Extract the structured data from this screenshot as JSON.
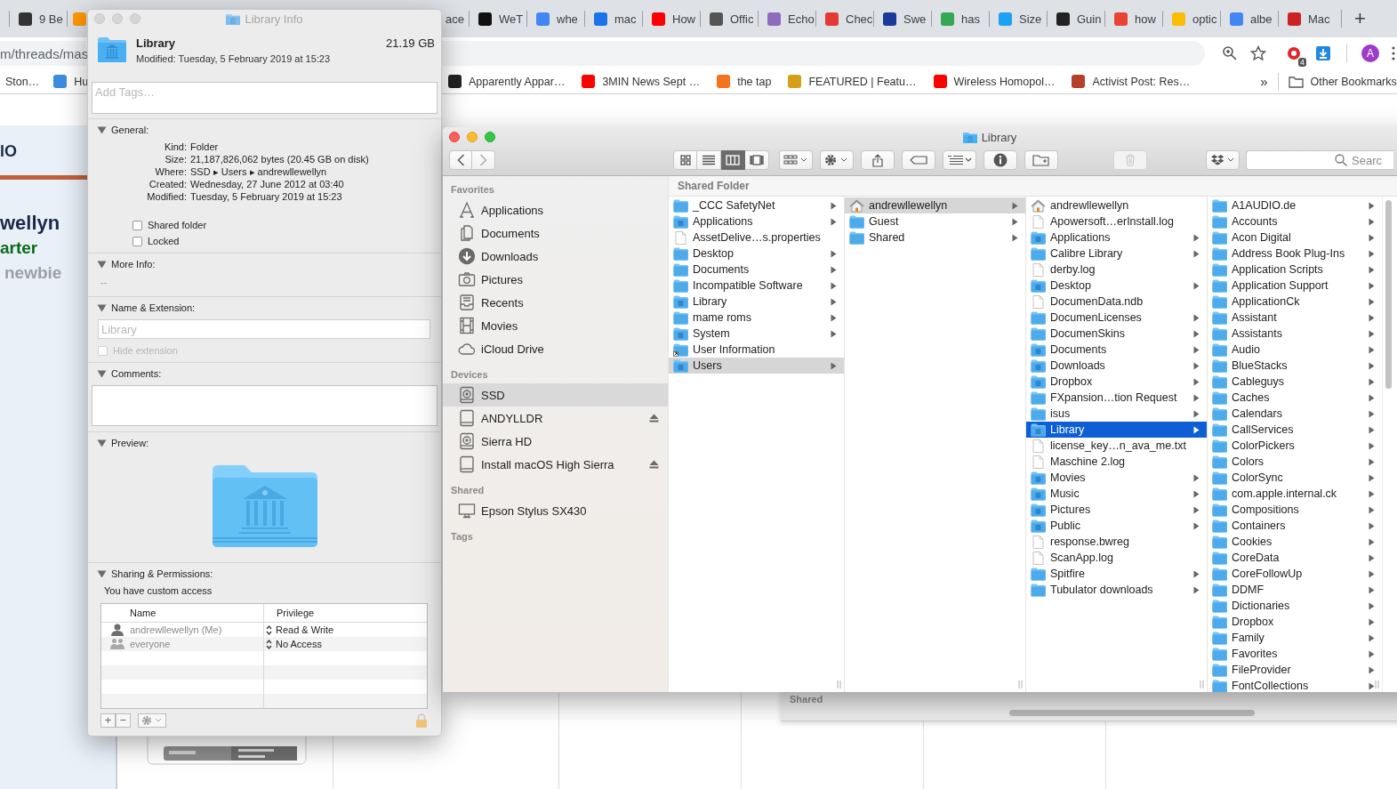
{
  "browser": {
    "tabs_left": [
      {
        "label": "9 Be",
        "color": "#333333"
      },
      {
        "color": "#ff9900"
      }
    ],
    "tabs_right": [
      {
        "label": "ace"
      },
      {
        "label": "WeT",
        "color": "#111111"
      },
      {
        "label": "whe",
        "color": "#4285f4"
      },
      {
        "label": "mac",
        "color": "#1a73e8"
      },
      {
        "label": "How",
        "color": "#ff0000"
      },
      {
        "label": "Offic",
        "color": "#555555"
      },
      {
        "label": "Echo",
        "color": "#8e6bbf"
      },
      {
        "label": "Chec",
        "color": "#e53935"
      },
      {
        "label": "Swe",
        "color": "#1a3a9a"
      },
      {
        "label": "has",
        "color": "#34a853"
      },
      {
        "label": "Size",
        "color": "#1da1f2"
      },
      {
        "label": "Guin",
        "color": "#222222"
      },
      {
        "label": "how",
        "color": "#ea4335"
      },
      {
        "label": "optic",
        "color": "#fbbc05"
      },
      {
        "label": "albe",
        "color": "#4285f4"
      },
      {
        "label": "Mac",
        "color": "#cc2222"
      }
    ],
    "new_tab": "+",
    "address": "m/threads/mas",
    "extension_badge": "4",
    "avatar": "A",
    "bookmarks_left": [
      {
        "label": "Ston…"
      },
      {
        "label": "Hu",
        "color": "#3b8de0"
      }
    ],
    "bookmarks_right": [
      {
        "label": "Apparently Appar…",
        "color": "#222222"
      },
      {
        "label": "3MIN News Sept …",
        "color": "#ff0000"
      },
      {
        "label": "the tap",
        "color": "#f4731f"
      },
      {
        "label": "FEATURED | Featu…",
        "color": "#d4a017"
      },
      {
        "label": "Wireless Homopol…",
        "color": "#ff0000"
      },
      {
        "label": "Activist Post: Res…",
        "color": "#b5402a"
      }
    ],
    "more": "»",
    "other_bookmarks": "Other Bookmarks"
  },
  "page": {
    "texts": [
      {
        "kind": "heading",
        "text": "lO"
      },
      {
        "kind": "name",
        "text": "wellyn"
      },
      {
        "kind": "rank",
        "text": "arter"
      },
      {
        "kind": "status",
        "text": "newbie"
      }
    ]
  },
  "info": {
    "title": "Library Info",
    "name": "Library",
    "size": "21.19 GB",
    "modified": "Modified: Tuesday, 5 February 2019 at 15:23",
    "tags_placeholder": "Add Tags…",
    "sections": [
      {
        "kind": "general",
        "title": "General:",
        "expanded": true,
        "rows": [
          {
            "label": "Kind:",
            "value": "Folder"
          },
          {
            "label": "Size:",
            "value": "21,187,826,062 bytes (20.45 GB on disk)"
          },
          {
            "label": "Where:",
            "value": "SSD ▸ Users ▸ andrewllewellyn"
          },
          {
            "label": "Created:",
            "value": "Wednesday, 27 June 2012 at 03:40"
          },
          {
            "label": "Modified:",
            "value": "Tuesday, 5 February 2019 at 15:23"
          }
        ],
        "checkboxes": [
          {
            "label": "Shared folder",
            "checked": false
          },
          {
            "label": "Locked",
            "checked": false
          }
        ]
      },
      {
        "kind": "more",
        "title": "More Info:",
        "expanded": true,
        "text": "--"
      },
      {
        "kind": "name",
        "title": "Name & Extension:",
        "expanded": true,
        "value": "Library",
        "disabled": true,
        "checkbox": {
          "label": "Hide extension",
          "checked": false,
          "disabled": true
        }
      },
      {
        "kind": "comments",
        "title": "Comments:",
        "expanded": true
      },
      {
        "kind": "preview",
        "title": "Preview:",
        "expanded": true
      },
      {
        "kind": "sharing",
        "title": "Sharing & Permissions:",
        "expanded": true,
        "note": "You have custom access",
        "columns": [
          "Name",
          "Privilege"
        ],
        "rows": [
          {
            "name": "andrewllewellyn (Me)",
            "kind": "user",
            "privilege": "Read & Write"
          },
          {
            "name": "everyone",
            "kind": "group",
            "privilege": "No Access"
          }
        ],
        "add": "+",
        "remove": "−"
      }
    ]
  },
  "finder": {
    "title": "Library",
    "views": [
      {
        "kind": "icons",
        "selected": false
      },
      {
        "kind": "list",
        "selected": false
      },
      {
        "kind": "columns",
        "selected": true
      },
      {
        "kind": "gallery",
        "selected": false
      }
    ],
    "trash_disabled": true,
    "search_placeholder": "Searc",
    "sidebar": [
      {
        "heading": "Favorites",
        "items": [
          {
            "name": "Applications",
            "kind": "apps",
            "selected": false,
            "eject": false
          },
          {
            "name": "Documents",
            "kind": "documents",
            "selected": false,
            "eject": false
          },
          {
            "name": "Downloads",
            "kind": "downloads",
            "selected": false,
            "eject": false
          },
          {
            "name": "Pictures",
            "kind": "pictures",
            "selected": false,
            "eject": false
          },
          {
            "name": "Recents",
            "kind": "recents",
            "selected": false,
            "eject": false
          },
          {
            "name": "Movies",
            "kind": "movies",
            "selected": false,
            "eject": false
          },
          {
            "name": "iCloud Drive",
            "kind": "cloud",
            "selected": false,
            "eject": false
          }
        ]
      },
      {
        "heading": "Devices",
        "items": [
          {
            "name": "SSD",
            "kind": "disk",
            "selected": true,
            "eject": false
          },
          {
            "name": "ANDYLLDR",
            "kind": "drive",
            "selected": false,
            "eject": true
          },
          {
            "name": "Sierra HD",
            "kind": "disk",
            "selected": false,
            "eject": false
          },
          {
            "name": "Install macOS High Sierra",
            "kind": "drive",
            "selected": false,
            "eject": true
          }
        ]
      },
      {
        "heading": "Shared",
        "items": [
          {
            "name": "Epson Stylus SX430",
            "kind": "display",
            "selected": false,
            "eject": false
          }
        ]
      },
      {
        "heading": "Tags"
      }
    ],
    "path_header": "Shared Folder",
    "columns": [
      {
        "focused": false,
        "items": [
          {
            "name": "_CCC SafetyNet",
            "kind": "folder",
            "arrow": true,
            "selected": false
          },
          {
            "name": "Applications",
            "kind": "special",
            "arrow": true,
            "selected": false
          },
          {
            "name": "AssetDelive…s.properties",
            "kind": "file",
            "arrow": false,
            "selected": false
          },
          {
            "name": "Desktop",
            "kind": "folder",
            "arrow": true,
            "selected": false
          },
          {
            "name": "Documents",
            "kind": "folder",
            "arrow": true,
            "selected": false
          },
          {
            "name": "Incompatible Software",
            "kind": "folder",
            "arrow": true,
            "selected": false
          },
          {
            "name": "Library",
            "kind": "special",
            "arrow": true,
            "selected": false
          },
          {
            "name": "mame roms",
            "kind": "folder",
            "arrow": true,
            "selected": false
          },
          {
            "name": "System",
            "kind": "special",
            "arrow": true,
            "selected": false
          },
          {
            "name": "User Information",
            "kind": "alias",
            "arrow": false,
            "selected": false
          },
          {
            "name": "Users",
            "kind": "special",
            "arrow": true,
            "selected": true
          }
        ]
      },
      {
        "focused": false,
        "items": [
          {
            "name": "andrewllewellyn",
            "kind": "home",
            "arrow": true,
            "selected": true
          },
          {
            "name": "Guest",
            "kind": "folder",
            "arrow": true,
            "selected": false
          },
          {
            "name": "Shared",
            "kind": "folder",
            "arrow": true,
            "selected": false
          }
        ]
      },
      {
        "focused": true,
        "items": [
          {
            "name": "andrewllewellyn",
            "kind": "home",
            "arrow": false,
            "selected": false
          },
          {
            "name": "Apowersoft…erInstall.log",
            "kind": "file",
            "arrow": false,
            "selected": false
          },
          {
            "name": "Applications",
            "kind": "special",
            "arrow": true,
            "selected": false
          },
          {
            "name": "Calibre Library",
            "kind": "folder",
            "arrow": true,
            "selected": false
          },
          {
            "name": "derby.log",
            "kind": "file",
            "arrow": false,
            "selected": false
          },
          {
            "name": "Desktop",
            "kind": "special",
            "arrow": true,
            "selected": false
          },
          {
            "name": "DocumenData.ndb",
            "kind": "file",
            "arrow": false,
            "selected": false
          },
          {
            "name": "DocumenLicenses",
            "kind": "folder",
            "arrow": true,
            "selected": false
          },
          {
            "name": "DocumenSkins",
            "kind": "folder",
            "arrow": true,
            "selected": false
          },
          {
            "name": "Documents",
            "kind": "special",
            "arrow": true,
            "selected": false
          },
          {
            "name": "Downloads",
            "kind": "special",
            "arrow": true,
            "selected": false
          },
          {
            "name": "Dropbox",
            "kind": "special",
            "arrow": true,
            "selected": false
          },
          {
            "name": "FXpansion…tion Request",
            "kind": "folder",
            "arrow": true,
            "selected": false
          },
          {
            "name": "isus",
            "kind": "folder",
            "arrow": true,
            "selected": false
          },
          {
            "name": "Library",
            "kind": "special",
            "arrow": true,
            "selected": true
          },
          {
            "name": "license_key…n_ava_me.txt",
            "kind": "file",
            "arrow": false,
            "selected": false
          },
          {
            "name": "Maschine 2.log",
            "kind": "file",
            "arrow": false,
            "selected": false
          },
          {
            "name": "Movies",
            "kind": "special",
            "arrow": true,
            "selected": false
          },
          {
            "name": "Music",
            "kind": "special",
            "arrow": true,
            "selected": false
          },
          {
            "name": "Pictures",
            "kind": "special",
            "arrow": true,
            "selected": false
          },
          {
            "name": "Public",
            "kind": "special",
            "arrow": true,
            "selected": false
          },
          {
            "name": "response.bwreg",
            "kind": "file",
            "arrow": false,
            "selected": false
          },
          {
            "name": "ScanApp.log",
            "kind": "file",
            "arrow": false,
            "selected": false
          },
          {
            "name": "Spitfire",
            "kind": "folder",
            "arrow": true,
            "selected": false
          },
          {
            "name": "Tubulator downloads",
            "kind": "folder",
            "arrow": true,
            "selected": false
          }
        ]
      },
      {
        "items": [
          {
            "name": "A1AUDIO.de",
            "kind": "folder",
            "arrow": true,
            "selected": false
          },
          {
            "name": "Accounts",
            "kind": "folder",
            "arrow": true,
            "selected": false
          },
          {
            "name": "Acon Digital",
            "kind": "folder",
            "arrow": true,
            "selected": false
          },
          {
            "name": "Address Book Plug-Ins",
            "kind": "folder",
            "arrow": true,
            "selected": false
          },
          {
            "name": "Application Scripts",
            "kind": "folder",
            "arrow": true,
            "selected": false
          },
          {
            "name": "Application Support",
            "kind": "folder",
            "arrow": true,
            "selected": false
          },
          {
            "name": "ApplicationCk",
            "kind": "folder",
            "arrow": true,
            "selected": false
          },
          {
            "name": "Assistant",
            "kind": "folder",
            "arrow": true,
            "selected": false
          },
          {
            "name": "Assistants",
            "kind": "folder",
            "arrow": true,
            "selected": false
          },
          {
            "name": "Audio",
            "kind": "folder",
            "arrow": true,
            "selected": false
          },
          {
            "name": "BlueStacks",
            "kind": "folder",
            "arrow": true,
            "selected": false
          },
          {
            "name": "Cableguys",
            "kind": "folder",
            "arrow": true,
            "selected": false
          },
          {
            "name": "Caches",
            "kind": "folder",
            "arrow": true,
            "selected": false
          },
          {
            "name": "Calendars",
            "kind": "folder",
            "arrow": true,
            "selected": false
          },
          {
            "name": "CallServices",
            "kind": "folder",
            "arrow": true,
            "selected": false
          },
          {
            "name": "ColorPickers",
            "kind": "folder",
            "arrow": true,
            "selected": false
          },
          {
            "name": "Colors",
            "kind": "folder",
            "arrow": true,
            "selected": false
          },
          {
            "name": "ColorSync",
            "kind": "folder",
            "arrow": true,
            "selected": false
          },
          {
            "name": "com.apple.internal.ck",
            "kind": "folder",
            "arrow": true,
            "selected": false
          },
          {
            "name": "Compositions",
            "kind": "folder",
            "arrow": true,
            "selected": false
          },
          {
            "name": "Containers",
            "kind": "folder",
            "arrow": true,
            "selected": false
          },
          {
            "name": "Cookies",
            "kind": "folder",
            "arrow": true,
            "selected": false
          },
          {
            "name": "CoreData",
            "kind": "folder",
            "arrow": true,
            "selected": false
          },
          {
            "name": "CoreFollowUp",
            "kind": "folder",
            "arrow": true,
            "selected": false
          },
          {
            "name": "DDMF",
            "kind": "folder",
            "arrow": true,
            "selected": false
          },
          {
            "name": "Dictionaries",
            "kind": "folder",
            "arrow": true,
            "selected": false
          },
          {
            "name": "Dropbox",
            "kind": "folder",
            "arrow": true,
            "selected": false
          },
          {
            "name": "Family",
            "kind": "folder",
            "arrow": true,
            "selected": false
          },
          {
            "name": "Favorites",
            "kind": "folder",
            "arrow": true,
            "selected": false
          },
          {
            "name": "FileProvider",
            "kind": "folder",
            "arrow": true,
            "selected": false
          },
          {
            "name": "FontCollections",
            "kind": "folder",
            "arrow": true,
            "selected": false
          }
        ]
      }
    ]
  },
  "behind": {
    "label": "Shared"
  }
}
